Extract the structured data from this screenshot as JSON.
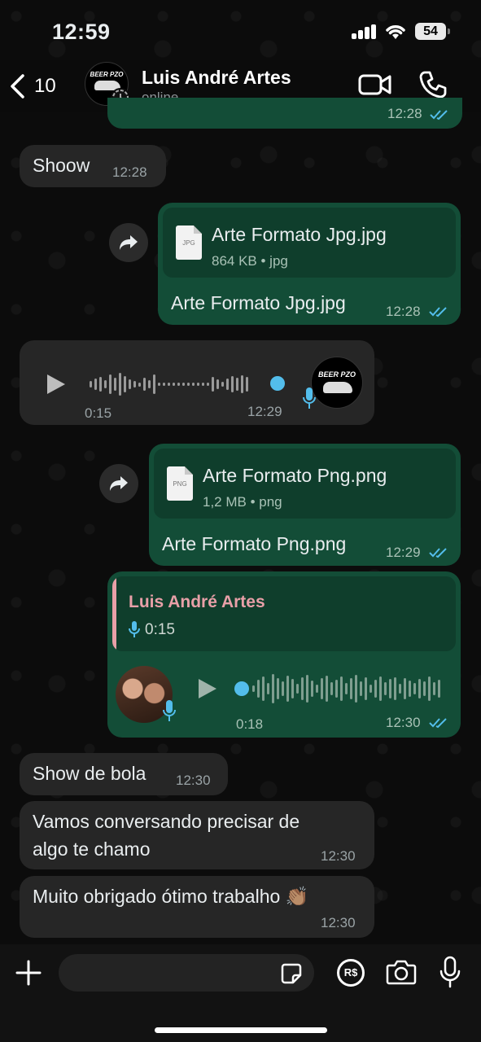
{
  "status_bar": {
    "time": "12:59",
    "battery": "54"
  },
  "header": {
    "back_count": "10",
    "contact_name": "Luis André Artes",
    "contact_status": "online",
    "avatar_brand": "BEER PZO"
  },
  "messages": [
    {
      "id": "m0",
      "direction": "out",
      "time": "12:28",
      "partial": true
    },
    {
      "id": "m1",
      "direction": "in",
      "text": "Shoow",
      "time": "12:28"
    },
    {
      "id": "m2",
      "direction": "out",
      "type": "document",
      "file_name": "Arte Formato Jpg.jpg",
      "file_ext_icon": "JPG",
      "file_info": "864 KB • jpg",
      "caption": "Arte Formato Jpg.jpg",
      "time": "12:28"
    },
    {
      "id": "m3",
      "direction": "in",
      "type": "voice",
      "duration": "0:15",
      "time": "12:29"
    },
    {
      "id": "m4",
      "direction": "out",
      "type": "document",
      "file_name": "Arte Formato Png.png",
      "file_ext_icon": "PNG",
      "file_info": "1,2 MB • png",
      "caption": "Arte Formato Png.png",
      "time": "12:29"
    },
    {
      "id": "m5",
      "direction": "out",
      "type": "voice_reply",
      "quoted_name": "Luis André Artes",
      "quoted_duration": "0:15",
      "duration": "0:18",
      "time": "12:30"
    },
    {
      "id": "m6",
      "direction": "in",
      "text": "Show de bola",
      "time": "12:30"
    },
    {
      "id": "m7",
      "direction": "in",
      "text_line1": "Vamos conversando precisar de",
      "text_line2": "algo te chamo",
      "time": "12:30"
    },
    {
      "id": "m8",
      "direction": "in",
      "text": "Muito obrigado ótimo trabalho 👏🏽",
      "time": "12:30"
    }
  ],
  "composer": {
    "placeholder": "",
    "currency_label": "R$"
  },
  "colors": {
    "outgoing": "#134d37",
    "incoming": "#262626",
    "accent_blue": "#53bdeb",
    "quoted_name": "#e8a0a8"
  }
}
